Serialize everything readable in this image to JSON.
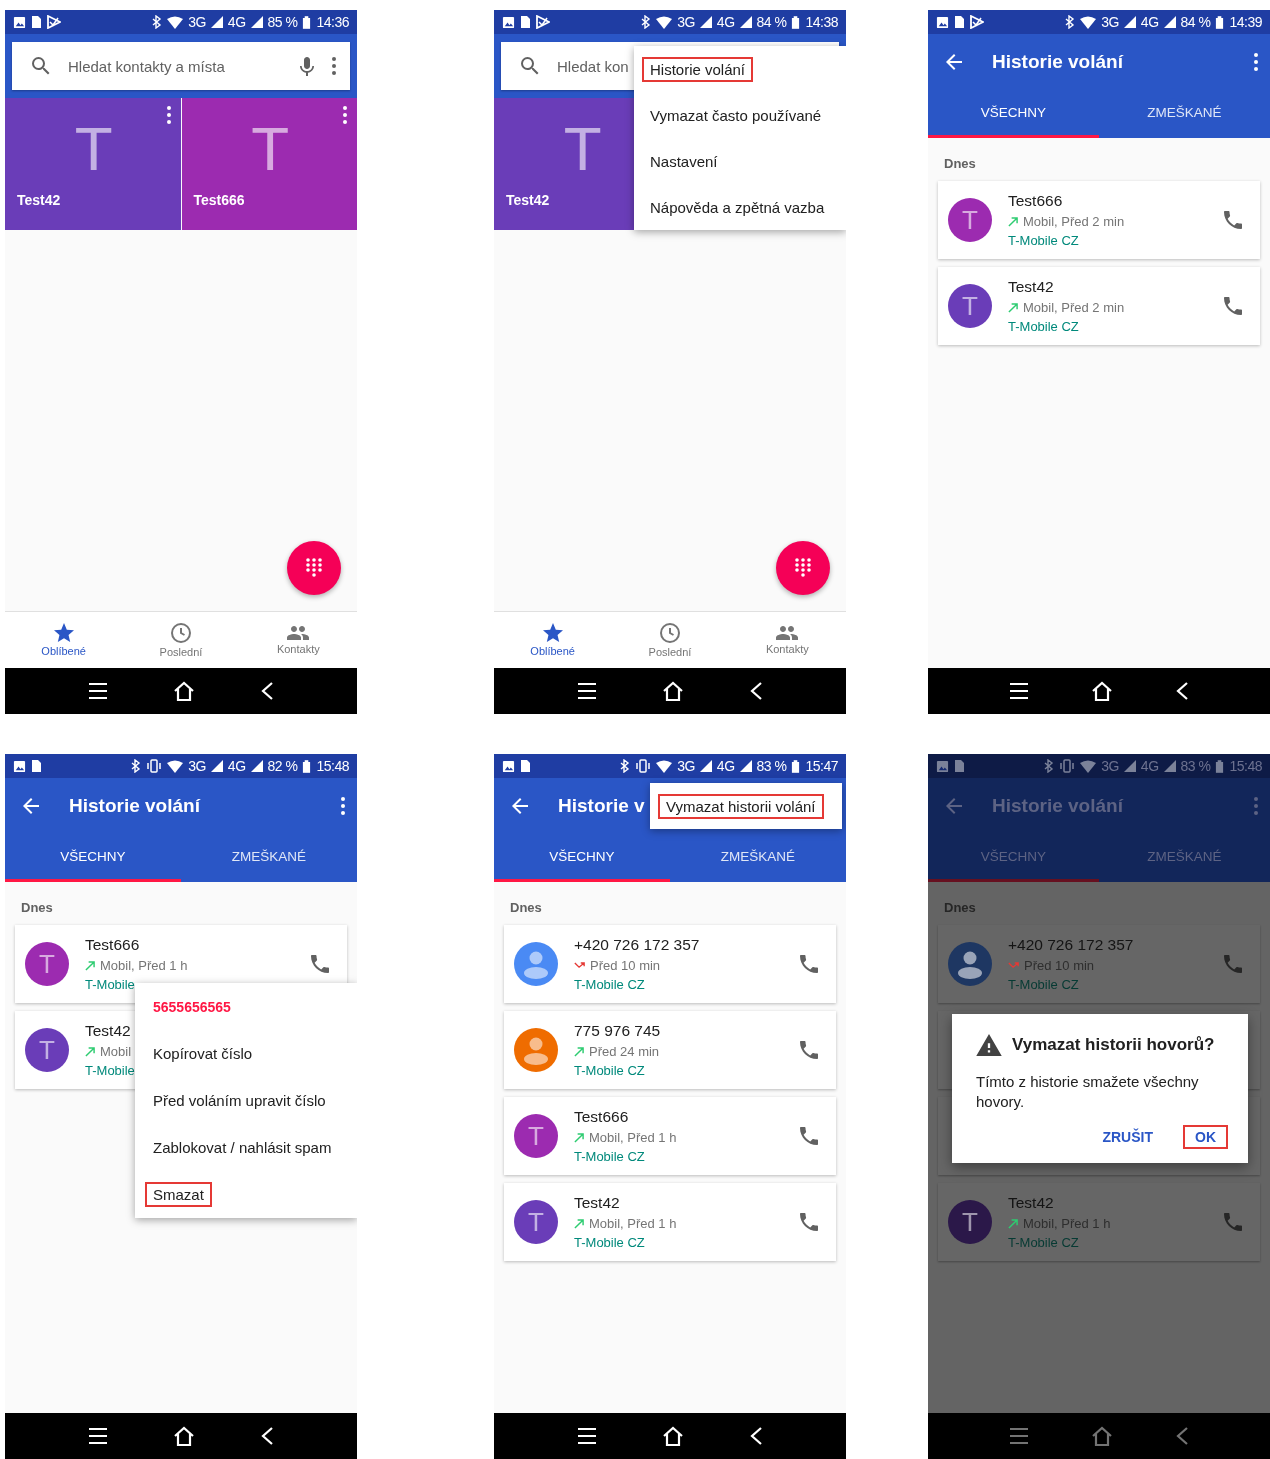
{
  "screens": [
    {
      "kind": "favorites",
      "status": {
        "store_icon": true,
        "vibrate": false,
        "networks": [
          "3G",
          "4G"
        ],
        "battery": "85 %",
        "time": "14:36"
      },
      "search": {
        "placeholder": "Hledat kontakty a místa",
        "mic": true,
        "more": true
      },
      "tiles": [
        {
          "letter": "T",
          "name": "Test42",
          "color": "#6a3db8",
          "more_button": true
        },
        {
          "letter": "T",
          "name": "Test666",
          "color": "#9c2bb0",
          "more_button": true
        }
      ],
      "fab": true,
      "bottom_nav": [
        {
          "label": "Oblíbené",
          "selected": true
        },
        {
          "label": "Poslední",
          "selected": false
        },
        {
          "label": "Kontakty",
          "selected": false
        }
      ]
    },
    {
      "kind": "favorites",
      "status": {
        "store_icon": true,
        "vibrate": false,
        "networks": [
          "3G",
          "4G"
        ],
        "battery": "84 %",
        "time": "14:38"
      },
      "search": {
        "placeholder": "Hledat kon",
        "mic": false,
        "more": false
      },
      "tiles": [
        {
          "letter": "T",
          "name": "Test42",
          "color": "#6a3db8",
          "more_button": false
        }
      ],
      "fab": true,
      "bottom_nav": [
        {
          "label": "Oblíbené",
          "selected": true
        },
        {
          "label": "Poslední",
          "selected": false
        },
        {
          "label": "Kontakty",
          "selected": false
        }
      ],
      "menu": {
        "kind": "overflow",
        "items": [
          {
            "label": "Historie volání",
            "highlighted": true
          },
          {
            "label": "Vymazat často používané",
            "highlighted": false
          },
          {
            "label": "Nastavení",
            "highlighted": false
          },
          {
            "label": "Nápověda a zpětná vazba",
            "highlighted": false
          }
        ]
      }
    },
    {
      "kind": "call_log",
      "status": {
        "store_icon": true,
        "vibrate": false,
        "networks": [
          "3G",
          "4G"
        ],
        "battery": "84 %",
        "time": "14:39"
      },
      "toolbar": {
        "title": "Historie volání",
        "more": true
      },
      "tabs": [
        {
          "label": "VŠECHNY",
          "selected": true
        },
        {
          "label": "ZMEŠKANÉ",
          "selected": false
        }
      ],
      "section": "Dnes",
      "calls": [
        {
          "kind": "outgoing",
          "avatar": {
            "kind": "letter",
            "letter": "T",
            "color": "#9c2bb0"
          },
          "name": "Test666",
          "detail": "Mobil, Před 2 min",
          "carrier": "T-Mobile CZ",
          "call_button": true
        },
        {
          "kind": "outgoing",
          "avatar": {
            "kind": "letter",
            "letter": "T",
            "color": "#6a3db8"
          },
          "name": "Test42",
          "detail": "Mobil, Před 2 min",
          "carrier": "T-Mobile CZ",
          "call_button": true
        }
      ]
    },
    {
      "kind": "call_log",
      "status": {
        "store_icon": false,
        "vibrate": true,
        "networks": [
          "3G",
          "4G"
        ],
        "battery": "82 %",
        "time": "15:48"
      },
      "toolbar": {
        "title": "Historie volání",
        "more": true
      },
      "tabs": [
        {
          "label": "VŠECHNY",
          "selected": true
        },
        {
          "label": "ZMEŠKANÉ",
          "selected": false
        }
      ],
      "section": "Dnes",
      "calls": [
        {
          "kind": "outgoing",
          "avatar": {
            "kind": "letter",
            "letter": "T",
            "color": "#9c2bb0"
          },
          "name": "Test666",
          "detail": "Mobil, Před 1 h",
          "carrier": "T-Mobile",
          "call_button": true
        },
        {
          "kind": "outgoing",
          "avatar": {
            "kind": "letter",
            "letter": "T",
            "color": "#6a3db8"
          },
          "name": "Test42",
          "detail": "Mobil",
          "carrier": "T-Mobile",
          "call_button": false
        }
      ],
      "menu": {
        "kind": "context",
        "header": "5655656565",
        "items": [
          {
            "label": "Kopírovat číslo",
            "highlighted": false
          },
          {
            "label": "Před voláním upravit číslo",
            "highlighted": false
          },
          {
            "label": "Zablokovat / nahlásit spam",
            "highlighted": false
          },
          {
            "label": "Smazat",
            "highlighted": true
          }
        ]
      }
    },
    {
      "kind": "call_log",
      "status": {
        "store_icon": false,
        "vibrate": true,
        "networks": [
          "3G",
          "4G"
        ],
        "battery": "83 %",
        "time": "15:47"
      },
      "toolbar": {
        "title": "Historie v",
        "more": false
      },
      "tabs": [
        {
          "label": "VŠECHNY",
          "selected": true
        },
        {
          "label": "ZMEŠKANÉ",
          "selected": false
        }
      ],
      "section": "Dnes",
      "calls": [
        {
          "kind": "missed",
          "avatar": {
            "kind": "person",
            "color": "#4a8af4"
          },
          "name": "+420 726 172 357",
          "detail": "Před 10 min",
          "carrier": "T-Mobile CZ",
          "call_button": true
        },
        {
          "kind": "outgoing",
          "avatar": {
            "kind": "person",
            "color": "#ef6c00"
          },
          "name": "775 976 745",
          "detail": "Před 24 min",
          "carrier": "T-Mobile CZ",
          "call_button": true
        },
        {
          "kind": "outgoing",
          "avatar": {
            "kind": "letter",
            "letter": "T",
            "color": "#9c2bb0"
          },
          "name": "Test666",
          "detail": "Mobil, Před 1 h",
          "carrier": "T-Mobile CZ",
          "call_button": true
        },
        {
          "kind": "outgoing",
          "avatar": {
            "kind": "letter",
            "letter": "T",
            "color": "#6a3db8"
          },
          "name": "Test42",
          "detail": "Mobil, Před 1 h",
          "carrier": "T-Mobile CZ",
          "call_button": true
        }
      ],
      "menu": {
        "kind": "overflow",
        "items": [
          {
            "label": "Vymazat historii volání",
            "highlighted": true
          }
        ]
      }
    },
    {
      "kind": "call_log",
      "status": {
        "store_icon": false,
        "vibrate": true,
        "networks": [
          "3G",
          "4G"
        ],
        "battery": "83 %",
        "time": "15:48"
      },
      "toolbar": {
        "title": "Historie volání",
        "more": true
      },
      "tabs": [
        {
          "label": "VŠECHNY",
          "selected": true
        },
        {
          "label": "ZMEŠKANÉ",
          "selected": false
        }
      ],
      "section": "Dnes",
      "calls": [
        {
          "kind": "missed",
          "avatar": {
            "kind": "person",
            "color": "#1e3762"
          },
          "name": "+420 726 172 357",
          "detail": "Před 10 min",
          "carrier": "T-Mobile CZ",
          "call_button": true
        },
        {
          "kind": "covered"
        },
        {
          "kind": "covered"
        },
        {
          "kind": "outgoing",
          "avatar": {
            "kind": "letter",
            "letter": "T",
            "color": "#2b1849"
          },
          "name": "Test42",
          "detail": "Mobil, Před 1 h",
          "carrier": "T-Mobile CZ",
          "call_button": true
        }
      ],
      "dimmed": true,
      "dialog": {
        "title": "Vymazat historii hovorů?",
        "body": "Tímto z historie smažete všechny hovory.",
        "buttons": [
          {
            "label": "ZRUŠIT",
            "highlighted": false
          },
          {
            "label": "OK",
            "highlighted": true
          }
        ]
      }
    }
  ]
}
